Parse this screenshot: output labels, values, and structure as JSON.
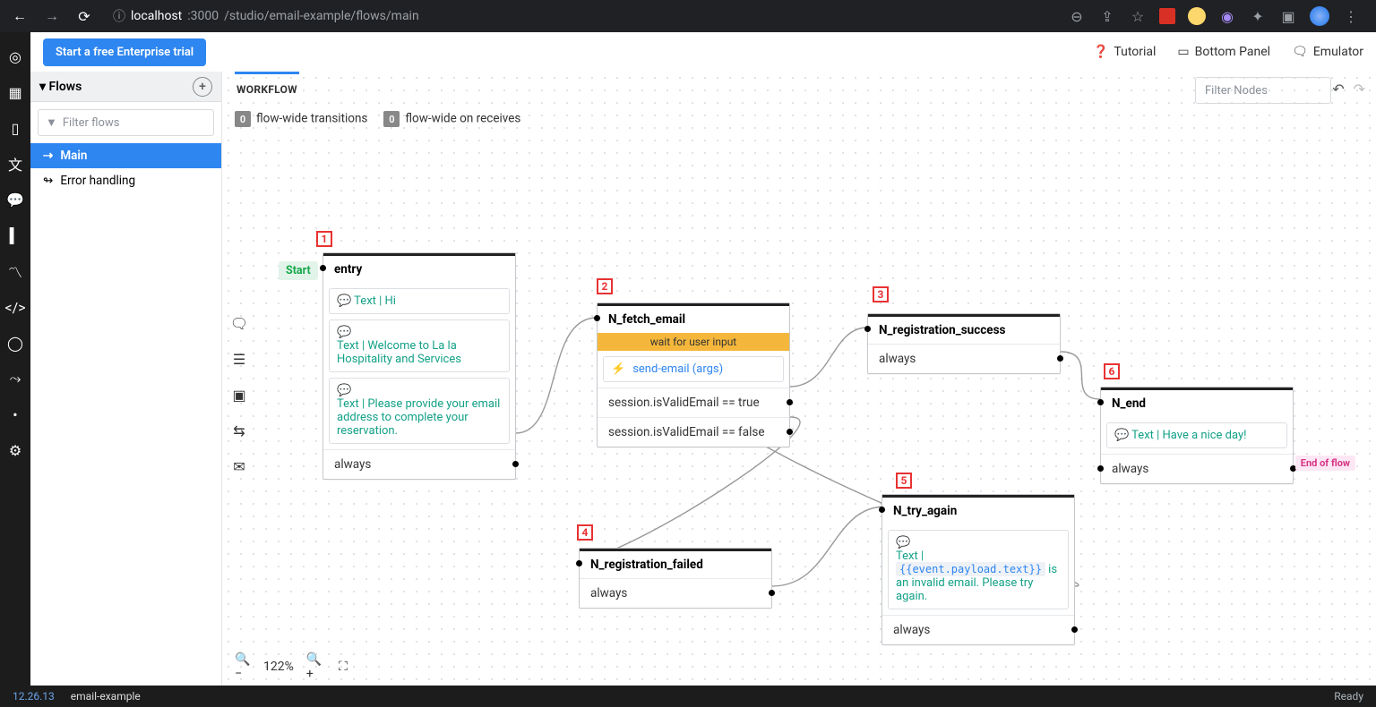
{
  "browser": {
    "url_host": "localhost",
    "url_port": ":3000",
    "url_path": "/studio/email-example/flows/main"
  },
  "topbar": {
    "trial": "Start a free Enterprise trial",
    "tutorial": "Tutorial",
    "bottom_panel": "Bottom Panel",
    "emulator": "Emulator"
  },
  "sidebar": {
    "flows_label": "Flows",
    "filter_placeholder": "Filter flows",
    "items": [
      {
        "label": "Main",
        "active": true
      },
      {
        "label": "Error handling",
        "active": false
      }
    ]
  },
  "workflow": {
    "tab": "WORKFLOW",
    "wide_transitions_count": "0",
    "wide_transitions_label": "flow-wide transitions",
    "wide_onreceives_count": "0",
    "wide_onreceives_label": "flow-wide on receives",
    "filter_nodes_placeholder": "Filter Nodes"
  },
  "zoom": {
    "pct": "122%"
  },
  "nodes": {
    "n1": {
      "num": "1",
      "start": "Start",
      "title": "entry",
      "msg1": "Text | Hi",
      "msg2": "Text | Welcome to La la Hospitality and Services",
      "msg3": "Text | Please provide your email address to complete your reservation.",
      "cond": "always"
    },
    "n2": {
      "num": "2",
      "title": "N_fetch_email",
      "banner": "wait for user input",
      "action": "send-email (args)",
      "cond1": "session.isValidEmail == true",
      "cond2": "session.isValidEmail == false"
    },
    "n3": {
      "num": "3",
      "title": "N_registration_success",
      "cond": "always"
    },
    "n4": {
      "num": "4",
      "title": "N_registration_failed",
      "cond": "always"
    },
    "n5": {
      "num": "5",
      "title": "N_try_again",
      "msg_pre": "Text | ",
      "msg_var": "{{event.payload.text}}",
      "msg_post": " is an invalid email. Please try again.",
      "cond": "always"
    },
    "n6": {
      "num": "6",
      "title": "N_end",
      "msg": "Text | Have a nice day!",
      "cond": "always",
      "eof": "End of flow"
    }
  },
  "status": {
    "version": "12.26.13",
    "project": "email-example",
    "ready": "Ready"
  }
}
